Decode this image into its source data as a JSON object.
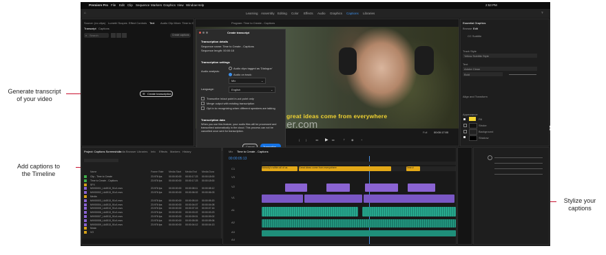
{
  "callouts": {
    "generate": "Generate transcript\nof your video",
    "captions": "Add captions to\nthe Timeline",
    "stylize": "Stylize your\ncaptions"
  },
  "watermark": "Cger.com",
  "mac_menu": [
    "Premiere Pro",
    "File",
    "Edit",
    "Clip",
    "Sequence",
    "Markers",
    "Graphics",
    "View",
    "Window",
    "Help"
  ],
  "clock": "2:53 PM",
  "workspaces": [
    "Learning",
    "Assembly",
    "Editing",
    "Color",
    "Effects",
    "Audio",
    "Graphics",
    "Captions",
    "Libraries"
  ],
  "left_panel": {
    "tabs": [
      "Source: (no clips)",
      "Lumetri Scopes",
      "Effect Controls",
      "Text",
      "Audio Clip Mixer: Time to Create - Captions"
    ],
    "subtabs": [
      "Transcript",
      "Captions"
    ],
    "search_placeholder": "Search",
    "create_button": "Create transcription",
    "create_captions": "Create captions"
  },
  "program": {
    "title": "Program: Time to Create - Captions",
    "caption": "great ideas come from everywhere",
    "fit": "Full",
    "timecode": "00:00:17:00"
  },
  "modal": {
    "title": "Create transcript",
    "details_header": "Transcription details",
    "sequence_name": "Sequence name: Time to Create - Captions",
    "sequence_length": "Sequence length: 00:00:18",
    "settings_header": "Transcription settings",
    "audio_analysis_label": "Audio analysis:",
    "option_dialogue": "Audio clips tagged as 'Dialogue'",
    "option_track": "Audio on track:",
    "track_value": "Mix",
    "language_label": "Language:",
    "language_value": "English",
    "checks": [
      "Transcribe in/out point in-out point only",
      "Merge output with existing transcription",
      "Opt in to recognizing when different speakers are talking"
    ],
    "data_header": "Transcription data",
    "data_text": "When you use this feature, your audio files will be processed and transcribed automatically in the cloud. This process can not be cancelled once sent for transcription.",
    "cancel": "Cancel",
    "transcribe": "Transcribe"
  },
  "project": {
    "tabs": [
      "Project: Captions Screenshots",
      "Media Browser",
      "Libraries",
      "Info",
      "Effects",
      "Markers",
      "History"
    ],
    "columns": [
      "Name",
      "Frame Rate",
      "Media Start",
      "Media End",
      "Media Dura"
    ],
    "items": [
      {
        "name": "Clip - Time to Create",
        "color": "#3fae49",
        "rate": "23.976 fps",
        "start": "00:00:00:00",
        "end": "00:00:17:23",
        "dur": "00:00:18:00"
      },
      {
        "name": "Time to Create - Captions",
        "color": "#3fae49",
        "rate": "23.976 fps",
        "start": "00:00:00:00",
        "end": "00:00:17:23",
        "dur": "00:00:18:00"
      },
      {
        "name": "SFX",
        "color": "#d4a017",
        "rate": "",
        "start": "",
        "end": "",
        "dur": ""
      },
      {
        "name": "MVI00001_LA4513_91v1.mov",
        "color": "#8a63d2",
        "rate": "23.976 fps",
        "start": "00:00:00:00",
        "end": "00:00:08:11",
        "dur": "00:00:08:12"
      },
      {
        "name": "MVI00002_LA4513_91v1.mov",
        "color": "#8a63d2",
        "rate": "23.976 fps",
        "start": "00:00:00:00",
        "end": "00:00:06:02",
        "dur": "00:00:06:03"
      },
      {
        "name": "Media",
        "color": "#d4a017",
        "rate": "",
        "start": "",
        "end": "",
        "dur": ""
      },
      {
        "name": "MVI00003_LA4513_91v1.mov",
        "color": "#8a63d2",
        "rate": "23.976 fps",
        "start": "00:00:00:00",
        "end": "00:00:05:19",
        "dur": "00:00:05:20"
      },
      {
        "name": "MVI00004_LA4513_91v1.mov",
        "color": "#8a63d2",
        "rate": "23.976 fps",
        "start": "00:00:00:00",
        "end": "00:00:04:07",
        "dur": "00:00:04:08"
      },
      {
        "name": "MVI00005_LA4513_91v1.mov",
        "color": "#8a63d2",
        "rate": "23.976 fps",
        "start": "00:00:00:00",
        "end": "00:00:07:15",
        "dur": "00:00:07:16"
      },
      {
        "name": "MVI00006_LA4513_91v1.mov",
        "color": "#8a63d2",
        "rate": "23.976 fps",
        "start": "00:00:00:00",
        "end": "00:00:03:22",
        "dur": "00:00:03:23"
      },
      {
        "name": "MVI00007_LA4513_91v1.mov",
        "color": "#8a63d2",
        "rate": "23.976 fps",
        "start": "00:00:00:00",
        "end": "00:00:09:01",
        "dur": "00:00:09:02"
      },
      {
        "name": "MVI00008_LA4513_91v1.mov",
        "color": "#8a63d2",
        "rate": "23.976 fps",
        "start": "00:00:00:00",
        "end": "00:00:05:05",
        "dur": "00:00:05:06"
      },
      {
        "name": "MVI00009_LA4513_91v1.mov",
        "color": "#8a63d2",
        "rate": "23.976 fps",
        "start": "00:00:00:00",
        "end": "00:00:04:12",
        "dur": "00:00:04:13"
      },
      {
        "name": "Music",
        "color": "#d4a017",
        "rate": "",
        "start": "",
        "end": "",
        "dur": ""
      },
      {
        "name": "VO",
        "color": "#d4a017",
        "rate": "",
        "start": "",
        "end": "",
        "dur": ""
      }
    ]
  },
  "timeline": {
    "tabs": [
      "Mix",
      "Time to Create - Captions"
    ],
    "timecode": "00:00:05:13",
    "caption_clips": [
      "Nobody's within all of us",
      "Great ideas come from everywhere",
      "Time #"
    ],
    "tracks": [
      "C1",
      "V3",
      "V2",
      "V1",
      "A1",
      "A2",
      "A3",
      "A4"
    ]
  },
  "essential_graphics": {
    "title": "Essential Graphics",
    "tabs": [
      "Browse",
      "Edit"
    ],
    "subtitle": "CC Subtitle",
    "track_style_label": "Track Style",
    "track_style_value": "Yellow Subtitle Style",
    "text_label": "Text",
    "font": "Adobe Clean",
    "weight": "Bold",
    "align_label": "Align and Transform",
    "appearance_label": "Appearance",
    "fill": "Fill",
    "stroke": "Stroke",
    "background": "Background",
    "shadow": "Shadow"
  }
}
